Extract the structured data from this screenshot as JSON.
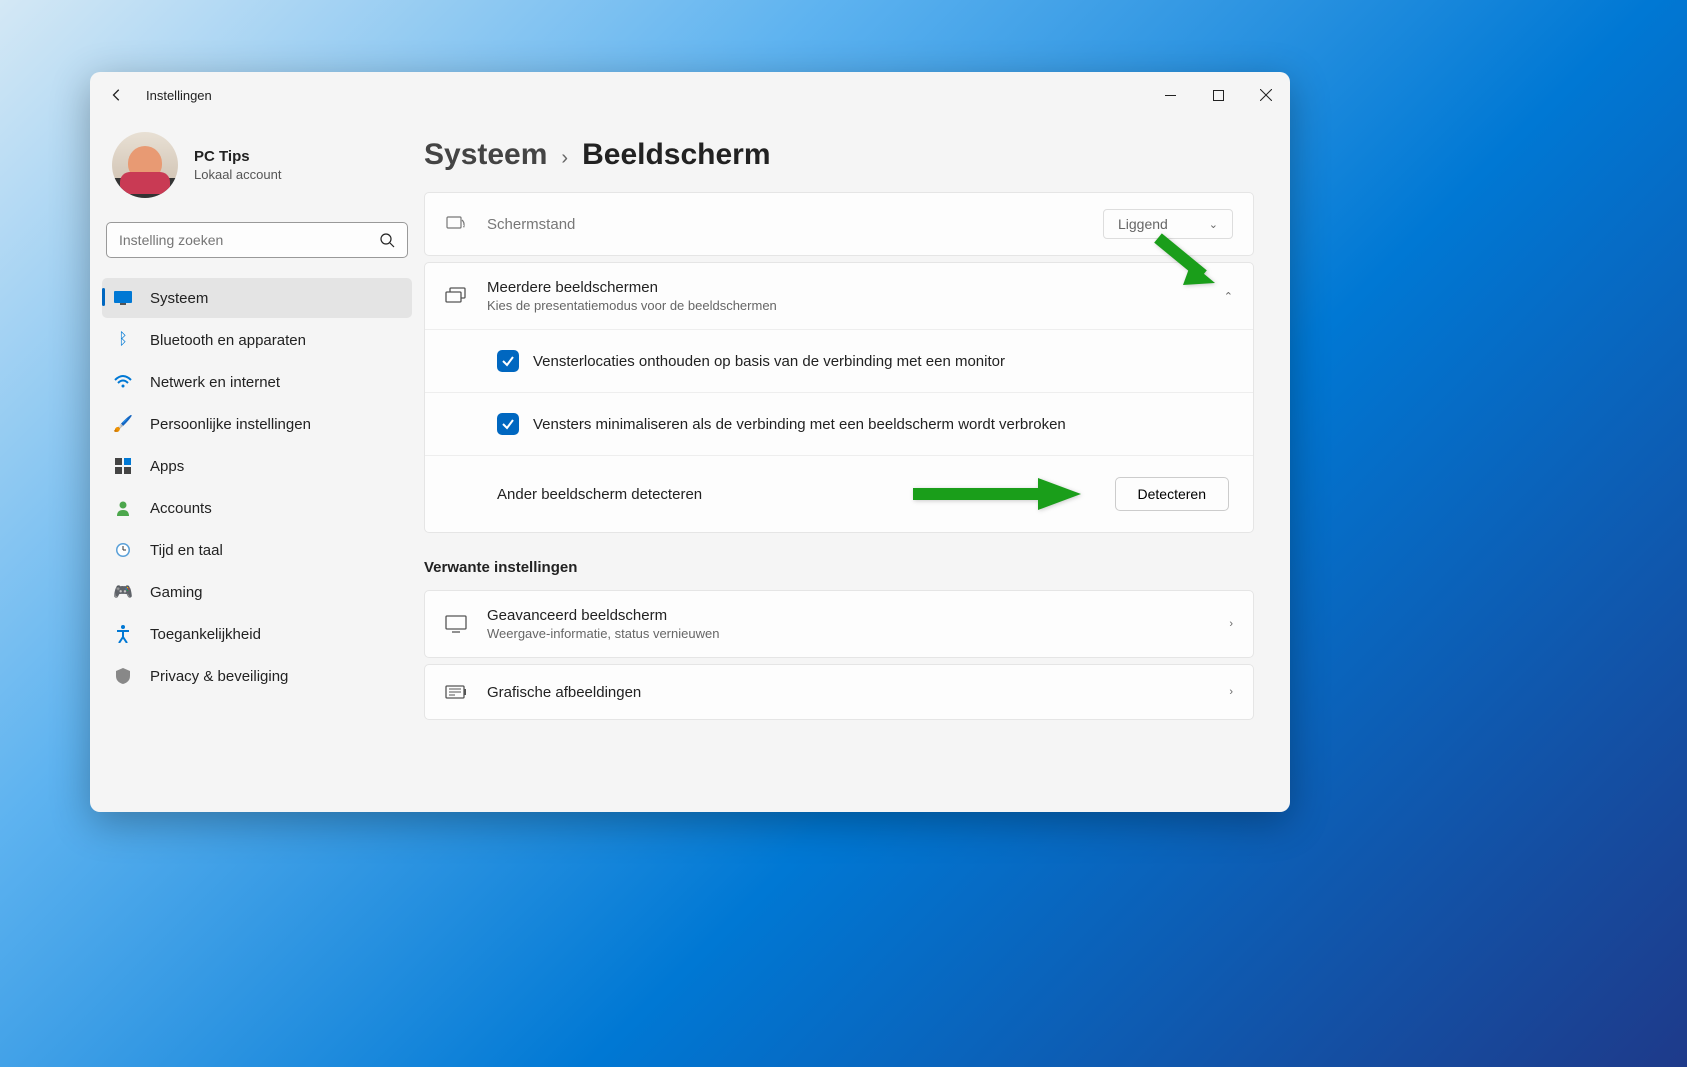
{
  "window": {
    "title": "Instellingen"
  },
  "profile": {
    "name": "PC Tips",
    "account_type": "Lokaal account"
  },
  "search": {
    "placeholder": "Instelling zoeken"
  },
  "sidebar": {
    "items": [
      {
        "label": "Systeem",
        "active": true
      },
      {
        "label": "Bluetooth en apparaten"
      },
      {
        "label": "Netwerk en internet"
      },
      {
        "label": "Persoonlijke instellingen"
      },
      {
        "label": "Apps"
      },
      {
        "label": "Accounts"
      },
      {
        "label": "Tijd en taal"
      },
      {
        "label": "Gaming"
      },
      {
        "label": "Toegankelijkheid"
      },
      {
        "label": "Privacy & beveiliging"
      }
    ]
  },
  "breadcrumb": {
    "parent": "Systeem",
    "current": "Beeldscherm"
  },
  "orientation": {
    "label": "Schermstand",
    "value": "Liggend"
  },
  "multi": {
    "title": "Meerdere beeldschermen",
    "subtitle": "Kies de presentatiemodus voor de beeldschermen",
    "check1": "Vensterlocaties onthouden op basis van de verbinding met een monitor",
    "check2": "Vensters minimaliseren als de verbinding met een beeldscherm wordt verbroken",
    "detect_label": "Ander beeldscherm detecteren",
    "detect_btn": "Detecteren"
  },
  "related": {
    "heading": "Verwante instellingen",
    "advanced": {
      "title": "Geavanceerd beeldscherm",
      "subtitle": "Weergave-informatie, status vernieuwen"
    },
    "graphics": {
      "title": "Grafische afbeeldingen"
    }
  }
}
